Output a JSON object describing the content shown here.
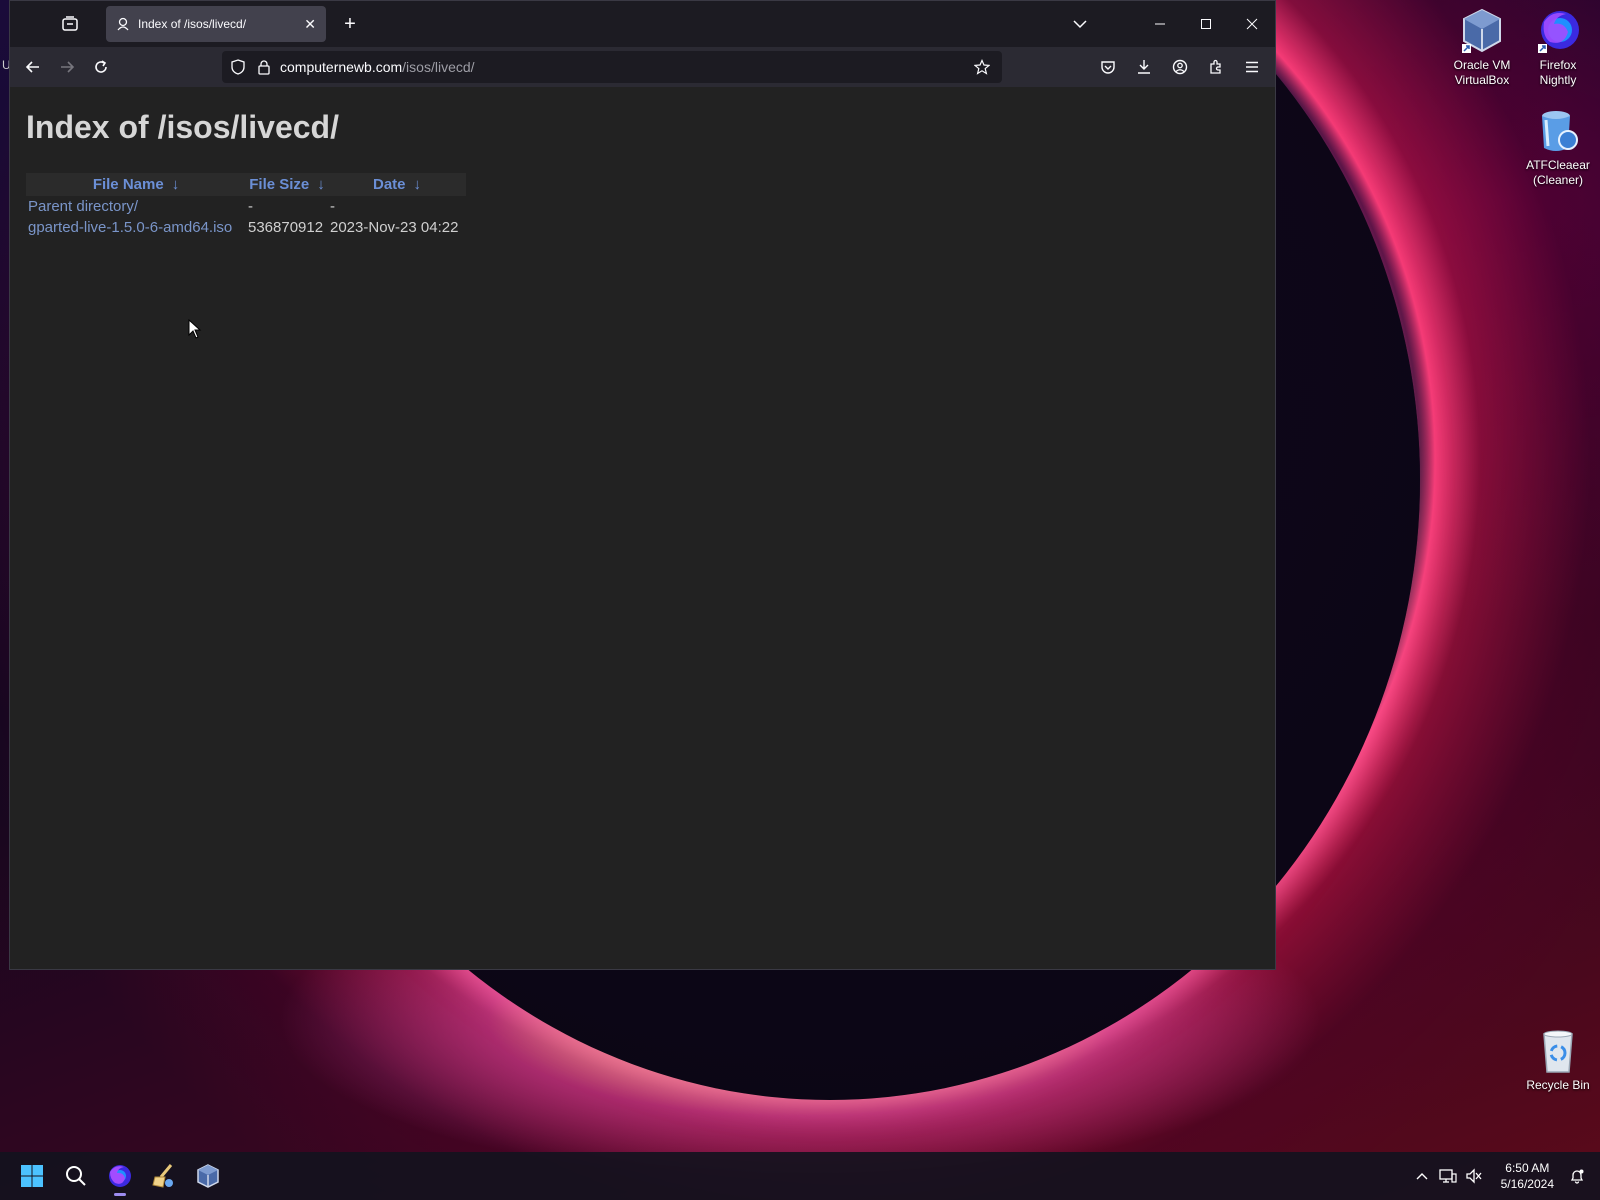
{
  "browser": {
    "tab_title": "Index of /isos/livecd/",
    "url_host": "computernewb.com",
    "url_path": "/isos/livecd/"
  },
  "page": {
    "heading": "Index of /isos/livecd/",
    "columns": [
      {
        "label": "File Name",
        "arrow": "↓"
      },
      {
        "label": "File Size",
        "arrow": "↓"
      },
      {
        "label": "Date",
        "arrow": "↓"
      }
    ],
    "rows": [
      {
        "name": "Parent directory/",
        "size": "-",
        "date": "-"
      },
      {
        "name": "gparted-live-1.5.0-6-amd64.iso",
        "size": "536870912",
        "date": "2023-Nov-23 04:22"
      }
    ]
  },
  "desktop": {
    "icons": [
      {
        "label_line1": "Oracle VM",
        "label_line2": "VirtualBox",
        "icon": "virtualbox-icon"
      },
      {
        "label_line1": "Firefox",
        "label_line2": "Nightly",
        "icon": "firefox-nightly-icon"
      },
      {
        "label_line1": "ATFCleaear",
        "label_line2": "(Cleaner)",
        "icon": "atf-cleaner-icon"
      },
      {
        "label_line1": "Recycle Bin",
        "label_line2": "",
        "icon": "recycle-bin-icon"
      }
    ],
    "edge_char": "U"
  },
  "taskbar": {
    "time": "6:50 AM",
    "date": "5/16/2024"
  },
  "colors": {
    "link": "#7a95c9",
    "header_link": "#6b8fd6",
    "page_bg": "#222222",
    "chrome_bg": "#1c1b22"
  }
}
